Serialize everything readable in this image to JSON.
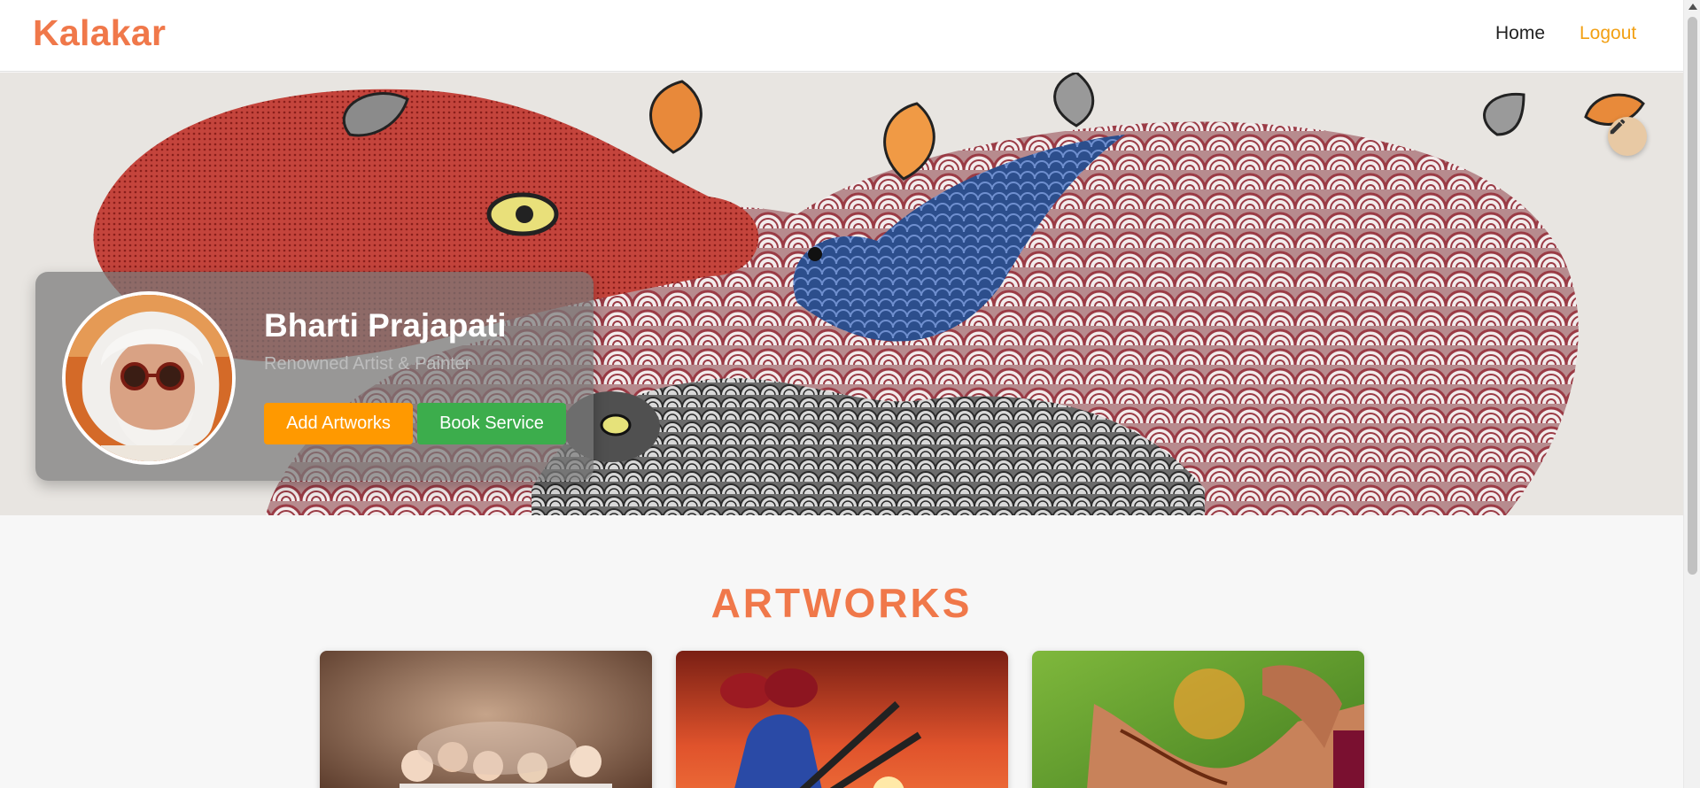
{
  "app": {
    "logo": "Kalakar"
  },
  "nav": {
    "home_label": "Home",
    "logout_label": "Logout"
  },
  "profile": {
    "name": "Bharti Prajapati",
    "subtitle": "Renowned Artist & Painter",
    "add_artworks_label": "Add Artworks",
    "book_service_label": "Book Service",
    "avatar_icon": "artist-portrait"
  },
  "cover": {
    "edit_icon": "pencil-icon",
    "artwork": "gond-painting"
  },
  "artworks": {
    "title": "ARTWORKS",
    "items": [
      {
        "image": "children-playing-holi-colors"
      },
      {
        "image": "rajasthani-musicians-sunset"
      },
      {
        "image": "mehndi-henna-feet"
      }
    ]
  },
  "colors": {
    "accent": "#f0784a",
    "logout": "#f2a014",
    "add_button": "#ff9900",
    "book_button": "#3cad4c"
  }
}
